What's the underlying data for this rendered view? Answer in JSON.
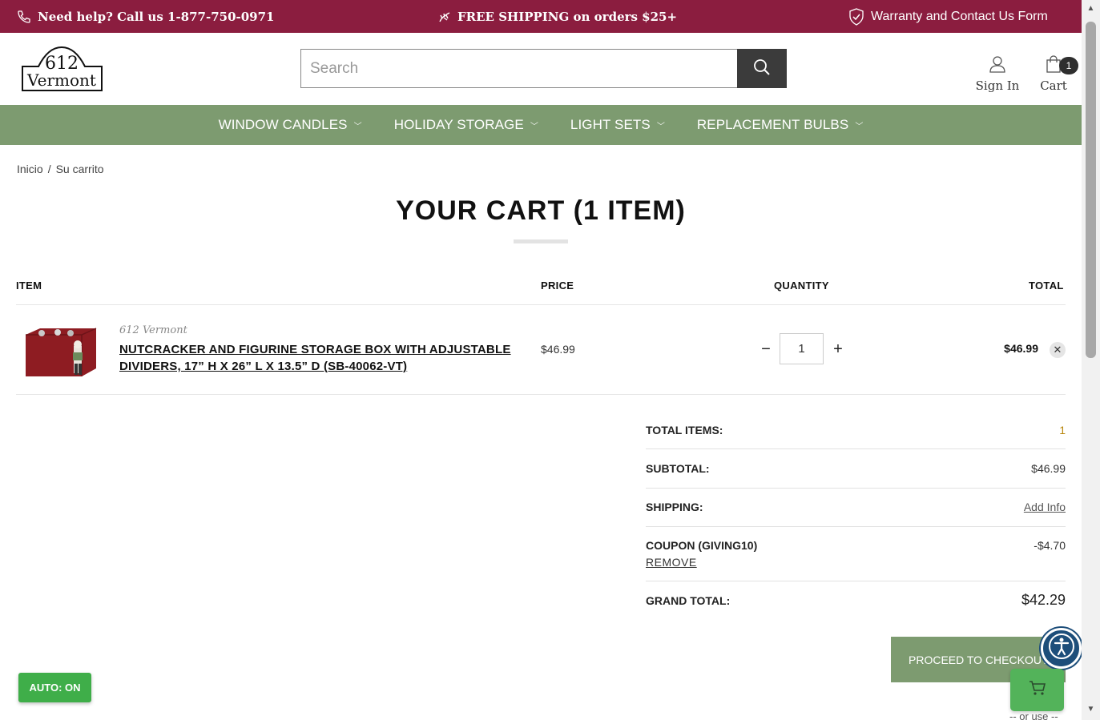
{
  "topbar": {
    "help_text": "Need help? Call us 1-877-750-0971",
    "shipping_text": "FREE SHIPPING on orders $25+",
    "warranty_text": "Warranty and Contact Us Form"
  },
  "header": {
    "logo_line1": "612",
    "logo_line2": "Vermont",
    "search_placeholder": "Search",
    "sign_in_label": "Sign In",
    "cart_label": "Cart",
    "cart_count": "1"
  },
  "nav": {
    "items": [
      {
        "label": "WINDOW CANDLES"
      },
      {
        "label": "HOLIDAY STORAGE"
      },
      {
        "label": "LIGHT SETS"
      },
      {
        "label": "REPLACEMENT BULBS"
      }
    ]
  },
  "breadcrumb": {
    "home": "Inicio",
    "separator": "/",
    "current": "Su carrito"
  },
  "page_title": "YOUR CART (1 ITEM)",
  "table": {
    "headers": {
      "item": "ITEM",
      "price": "PRICE",
      "quantity": "QUANTITY",
      "total": "TOTAL"
    },
    "rows": [
      {
        "brand": "612 Vermont",
        "name": "NUTCRACKER AND FIGURINE STORAGE BOX WITH ADJUSTABLE DIVIDERS, 17” H X 26” L X 13.5” D (SB-40062-VT)",
        "price": "$46.99",
        "quantity": "1",
        "total": "$46.99"
      }
    ]
  },
  "totals": {
    "total_items_label": "TOTAL ITEMS:",
    "total_items_value": "1",
    "subtotal_label": "SUBTOTAL:",
    "subtotal_value": "$46.99",
    "shipping_label": "SHIPPING:",
    "shipping_value": "Add Info",
    "coupon_label": "COUPON (GIVING10)",
    "coupon_value": "-$4.70",
    "coupon_remove": "REMOVE",
    "grand_total_label": "GRAND TOTAL:",
    "grand_total_value": "$42.29"
  },
  "checkout_label": "PROCEED TO CHECKOUT",
  "or_use_text": "-- or use --",
  "auto_badge": "AUTO: ON",
  "colors": {
    "topbar": "#8b1d3f",
    "nav": "#7d9b70",
    "search_button": "#3b3b3b",
    "auto_badge": "#3fae49",
    "accessibility": "#1d4e7a"
  }
}
